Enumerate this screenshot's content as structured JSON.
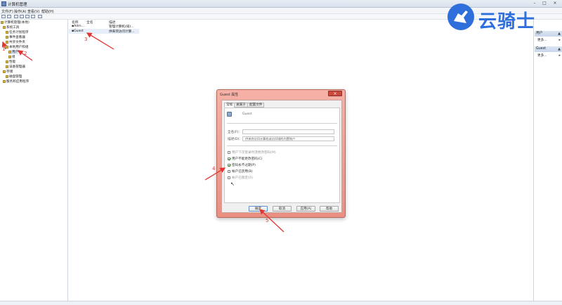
{
  "window": {
    "title": "计算机管理",
    "icon": "computer-management-icon"
  },
  "menu": [
    "文件(F)",
    "操作(A)",
    "查看(V)",
    "帮助(H)"
  ],
  "toolbar_icons": [
    "back-icon",
    "forward-icon",
    "up-icon",
    "show-hide-tree-icon",
    "refresh-icon",
    "export-icon",
    "help-icon"
  ],
  "tree": {
    "items": [
      {
        "label": "计算机管理(本地)"
      },
      {
        "label": "系统工具"
      },
      {
        "label": "任务计划程序"
      },
      {
        "label": "事件查看器"
      },
      {
        "label": "共享文件夹"
      },
      {
        "label": "本地用户和组"
      },
      {
        "label": "用户"
      },
      {
        "label": "组"
      },
      {
        "label": "性能"
      },
      {
        "label": "设备管理器"
      },
      {
        "label": "存储"
      },
      {
        "label": "磁盘管理"
      },
      {
        "label": "服务和应用程序"
      }
    ]
  },
  "list": {
    "columns": [
      "名称",
      "全名",
      "描述"
    ],
    "rows": [
      {
        "name": "Adm...",
        "fullname": "",
        "desc": "管理计算机(域)..."
      },
      {
        "name": "Guest",
        "fullname": "",
        "desc": "供来宾访问计算..."
      }
    ]
  },
  "actions": {
    "sections": [
      {
        "header": "用户",
        "more": "更多..."
      },
      {
        "header": "Guest",
        "more": "更多..."
      }
    ]
  },
  "watermark": {
    "text": "云骑士"
  },
  "dialog": {
    "title": "Guest 属性",
    "tabs": [
      "常规",
      "隶属于",
      "配置文件"
    ],
    "username": "Guest",
    "fullname_label": "全名(F):",
    "fullname_value": "",
    "desc_label": "描述(D):",
    "desc_value": "供来宾访问计算机或访问域的内置帐户",
    "checkboxes": [
      {
        "label": "用户下次登录时须更改密码(M)",
        "checked": false,
        "disabled": true
      },
      {
        "label": "用户不能更改密码(C)",
        "checked": true,
        "disabled": false
      },
      {
        "label": "密码永不过期(P)",
        "checked": true,
        "disabled": false
      },
      {
        "label": "帐户已禁用(B)",
        "checked": false,
        "disabled": false
      },
      {
        "label": "帐户已锁定(O)",
        "checked": false,
        "disabled": true
      }
    ],
    "buttons": {
      "ok": "确定",
      "cancel": "取消",
      "apply": "应用(A)",
      "help": "帮助"
    }
  },
  "annotations": {
    "n1": "1",
    "n2": "2",
    "n3": "3",
    "n4": "4",
    "n5": "5"
  },
  "colors": {
    "annotation": "#e33333",
    "watermark": "#2f6fdb",
    "dialog_frame": "#e98f82"
  }
}
